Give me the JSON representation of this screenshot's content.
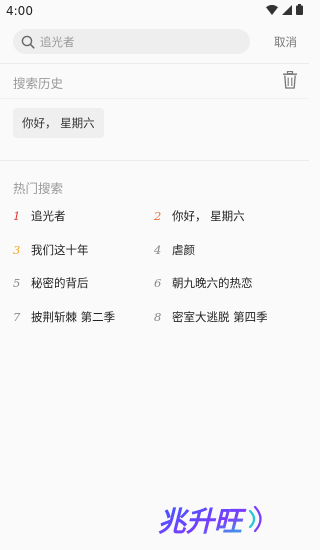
{
  "status_bar": {
    "time": "4:00",
    "icons": [
      "wifi-icon",
      "signal-icon",
      "battery-icon"
    ]
  },
  "search": {
    "placeholder": "追光者",
    "cancel_label": "取消",
    "icon": "search-icon"
  },
  "history": {
    "title": "搜索历史",
    "clear_icon": "trash-icon",
    "items": [
      "你好， 星期六"
    ]
  },
  "hot": {
    "title": "热门搜索",
    "items": [
      {
        "rank": "1",
        "label": "追光者"
      },
      {
        "rank": "2",
        "label": "你好， 星期六"
      },
      {
        "rank": "3",
        "label": "我们这十年"
      },
      {
        "rank": "4",
        "label": "虐颜"
      },
      {
        "rank": "5",
        "label": "秘密的背后"
      },
      {
        "rank": "6",
        "label": "朝九晚六的热恋"
      },
      {
        "rank": "7",
        "label": "披荆斩棘 第二季"
      },
      {
        "rank": "8",
        "label": "密室大逃脱 第四季"
      }
    ]
  },
  "colors": {
    "rank1": "#e53935",
    "rank2": "#ef6c3a",
    "rank3": "#f5a623",
    "rank_other": "#888888"
  },
  "watermark": {
    "text": "兆升旺",
    "icon": "watermark-logo-icon"
  }
}
